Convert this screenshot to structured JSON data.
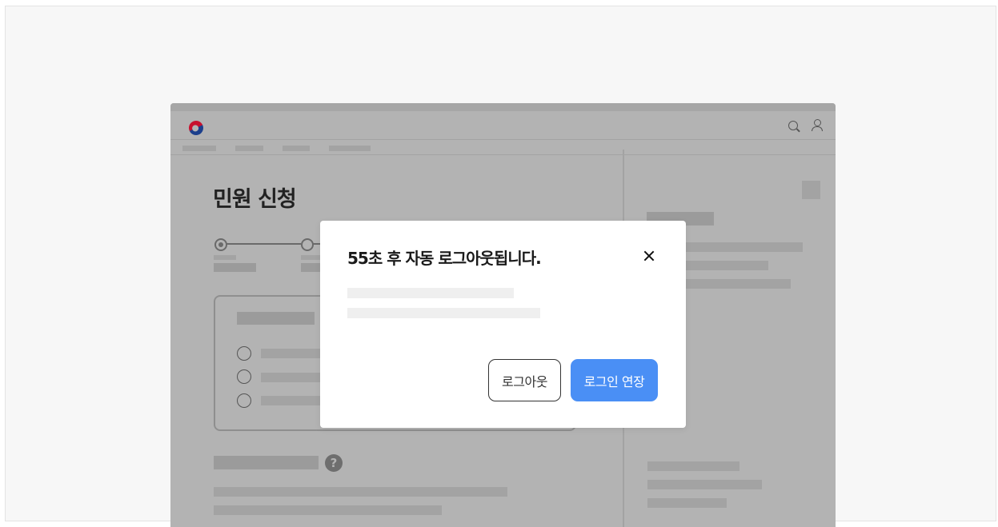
{
  "page": {
    "title": "민원 신청"
  },
  "header": {
    "logo_icon": "korea-government-logo-icon",
    "search_icon": "search-icon",
    "user_icon": "user-icon"
  },
  "dialog": {
    "title": "55초 후 자동 로그아웃됩니다.",
    "countdown_seconds": 55,
    "close_icon": "close-icon",
    "logout_label": "로그아웃",
    "extend_label": "로그인 연장"
  },
  "colors": {
    "primary_button": "#4a8ff5",
    "overlay": "#b3b3b3"
  }
}
